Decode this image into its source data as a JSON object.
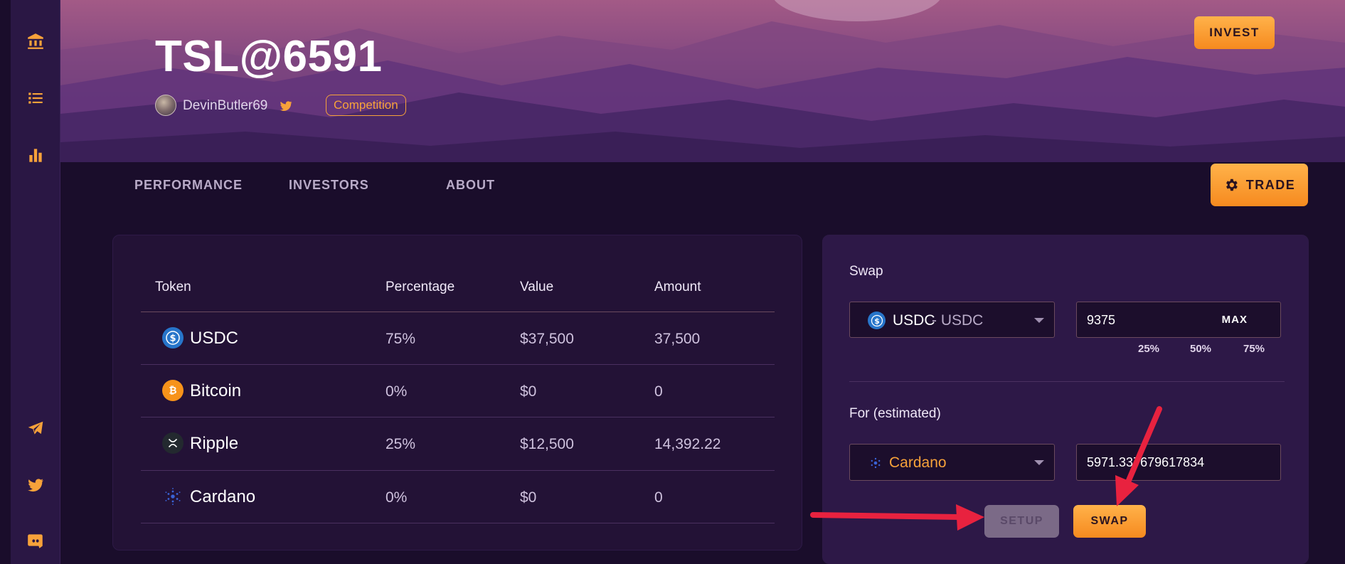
{
  "header": {
    "title": "TSL@6591",
    "username": "DevinButler69",
    "badge": "Competition",
    "invest_label": "INVEST",
    "trade_label": "TRADE"
  },
  "tabs": [
    {
      "label": "PERFORMANCE"
    },
    {
      "label": "INVESTORS"
    },
    {
      "label": "ABOUT"
    }
  ],
  "table": {
    "headers": [
      "Token",
      "Percentage",
      "Value",
      "Amount"
    ],
    "rows": [
      {
        "name": "USDC",
        "percentage": "75%",
        "value": "$37,500",
        "amount": "37,500"
      },
      {
        "name": "Bitcoin",
        "percentage": "0%",
        "value": "$0",
        "amount": "0"
      },
      {
        "name": "Ripple",
        "percentage": "25%",
        "value": "$12,500",
        "amount": "14,392.22"
      },
      {
        "name": "Cardano",
        "percentage": "0%",
        "value": "$0",
        "amount": "0"
      }
    ]
  },
  "swap": {
    "label": "Swap",
    "from_token": "USDC",
    "from_token_suffix": " - USDC",
    "from_amount": "9375",
    "max_label": "MAX",
    "percent_options": [
      "25%",
      "50%",
      "75%"
    ],
    "for_label": "For (estimated)",
    "to_token": "Cardano",
    "to_amount": "5971.337679617834",
    "setup_label": "SETUP",
    "swap_label": "SWAP"
  },
  "colors": {
    "accent": "#f7a23a",
    "background": "#1a0d2b",
    "card": "#231236",
    "annotation_arrow": "#e8223f"
  },
  "icons": {
    "sidebar_top": [
      "bank-icon",
      "list-icon",
      "bar-chart-icon"
    ],
    "sidebar_bottom": [
      "telegram-icon",
      "twitter-icon",
      "discord-icon"
    ]
  }
}
